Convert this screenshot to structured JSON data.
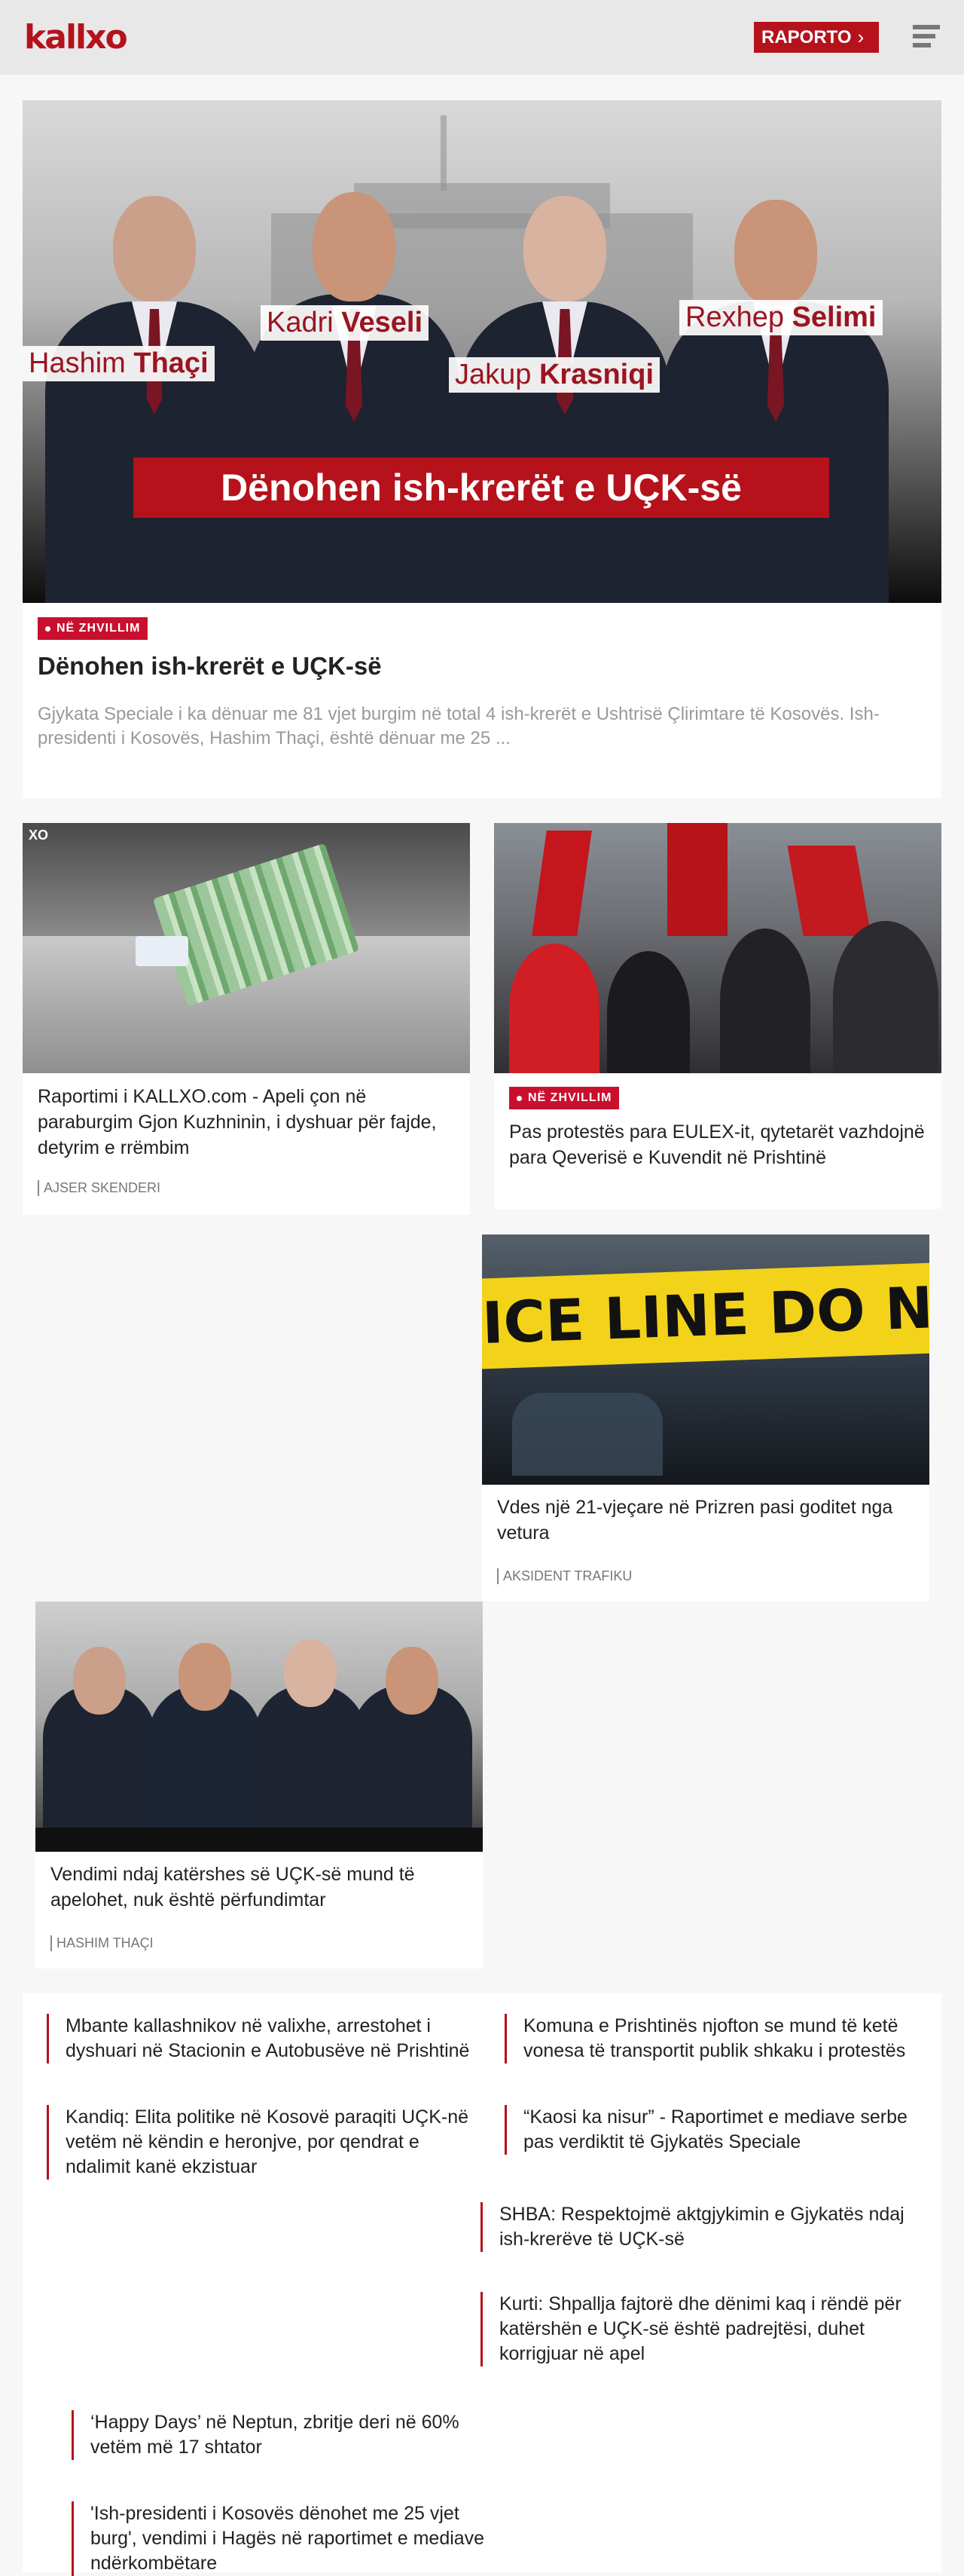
{
  "header": {
    "logo": "kallxo",
    "report_button": "RAPORTO",
    "report_chevron": "›"
  },
  "hero": {
    "image_labels": [
      {
        "first": "Hashim ",
        "last": "Thaçi"
      },
      {
        "first": "Kadri ",
        "last": "Veseli"
      },
      {
        "first": "Jakup ",
        "last": "Krasniqi"
      },
      {
        "first": "Rexhep ",
        "last": "Selimi"
      }
    ],
    "image_banner": "Dënohen ish-krerët e UÇK-së",
    "badge": "NË ZHVILLIM",
    "title": "Dënohen ish-krerët e UÇK-së",
    "description": "Gjykata Speciale i ka dënuar me 81 vjet burgim në total 4 ish-krerët e Ushtrisë Çlirimtare të Kosovës. Ish-presidenti i Kosovës, Hashim Thaçi, është dënuar me 25 ..."
  },
  "cards": [
    {
      "title": "Raportimi i KALLXO.com - Apeli çon në paraburgim Gjon Kuzhninin, i dyshuar për fajde, detyrim e rrëmbim",
      "author": "AJSER SKENDERI",
      "thumb_mark": "XO"
    },
    {
      "title": "Pas protestës para EULEX-it, qytetarët vazhdojnë para Qeverisë e Kuvendit në Prishtinë",
      "badge": "NË ZHVILLIM"
    },
    {
      "title": "Vdes një 21-vjeçare në Prizren pasi goditet nga vetura",
      "author": "AKSIDENT TRAFIKU",
      "tape_text": "ICE LINE DO NOT CRO"
    },
    {
      "title": "Vendimi ndaj katërshes së UÇK-së mund të apelohet, nuk është përfundimtar",
      "author": "HASHIM THAÇI"
    }
  ],
  "links": [
    "Mbante kallashnikov në valixhe, arrestohet i dyshuari në Stacionin e Autobusëve në Prishtinë",
    "Komuna e Prishtinës njofton se mund të ketë vonesa të transportit publik shkaku i protestës",
    "Kandiq: Elita politike në Kosovë paraqiti UÇK-në vetëm në këndin e heronjve, por qendrat e ndalimit kanë ekzistuar",
    "“Kaosi ka nisur” - Raportimet e mediave serbe pas verdiktit të Gjykatës Speciale",
    "SHBA: Respektojmë aktgjykimin e Gjykatës ndaj ish-krerëve të UÇK-së",
    "Kurti: Shpallja fajtorë dhe dënimi kaq i rëndë për katërshën e UÇK-së është padrejtësi, duhet korrigjuar në apel",
    "‘Happy Days’ në Neptun, zbritje deri në 60% vetëm më 17 shtator",
    "'Ish-presidenti i Kosovës dënohet me 25 vjet burg', vendimi i Hagës në raportimet e mediave ndërkombëtare"
  ],
  "colors": {
    "accent": "#b5121b",
    "badge": "#c8102e",
    "background": "#f7f7f7"
  },
  "icons": {
    "menu": "hamburger-menu-icon",
    "report": "chevron-right-icon",
    "live": "dot-icon"
  }
}
